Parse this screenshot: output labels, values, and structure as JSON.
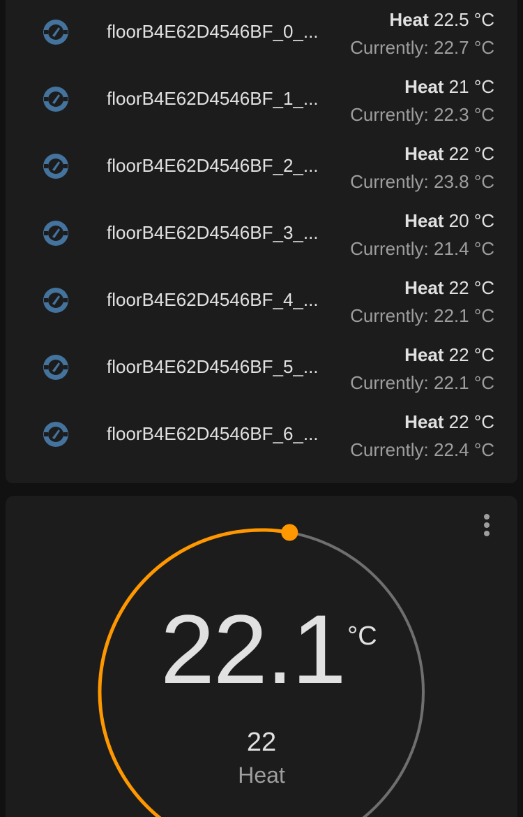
{
  "thermostats": [
    {
      "name": "floorB4E62D4546BF_0_...",
      "mode": "Heat",
      "target": "22.5 °C",
      "current": "Currently: 22.7 °C"
    },
    {
      "name": "floorB4E62D4546BF_1_...",
      "mode": "Heat",
      "target": "21 °C",
      "current": "Currently: 22.3 °C"
    },
    {
      "name": "floorB4E62D4546BF_2_...",
      "mode": "Heat",
      "target": "22 °C",
      "current": "Currently: 23.8 °C"
    },
    {
      "name": "floorB4E62D4546BF_3_...",
      "mode": "Heat",
      "target": "20 °C",
      "current": "Currently: 21.4 °C"
    },
    {
      "name": "floorB4E62D4546BF_4_...",
      "mode": "Heat",
      "target": "22 °C",
      "current": "Currently: 22.1 °C"
    },
    {
      "name": "floorB4E62D4546BF_5_...",
      "mode": "Heat",
      "target": "22 °C",
      "current": "Currently: 22.1 °C"
    },
    {
      "name": "floorB4E62D4546BF_6_...",
      "mode": "Heat",
      "target": "22 °C",
      "current": "Currently: 22.4 °C"
    }
  ],
  "thermostat_card": {
    "current_temp": "22.1",
    "unit": "°C",
    "setpoint": "22",
    "mode": "Heat"
  },
  "icons": {
    "row_icon": "thermostat-icon",
    "menu": "more-vertical-icon"
  },
  "colors": {
    "card_bg": "#1c1c1c",
    "icon": "#44739e",
    "arc_active": "#ff9800",
    "arc_inactive": "#6f6f6f",
    "primary_text": "#e1e1e1",
    "secondary_text": "#9e9e9e"
  }
}
